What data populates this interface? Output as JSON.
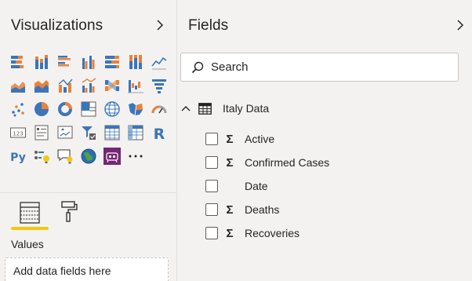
{
  "visualizations": {
    "title": "Visualizations",
    "chevron_icon": "chevron-right-icon",
    "tiles": [
      {
        "name": "stacked-bar-chart-icon"
      },
      {
        "name": "stacked-column-chart-icon"
      },
      {
        "name": "clustered-bar-chart-icon"
      },
      {
        "name": "clustered-column-chart-icon"
      },
      {
        "name": "100-stacked-bar-chart-icon"
      },
      {
        "name": "100-stacked-column-chart-icon"
      },
      {
        "name": "line-chart-icon"
      },
      {
        "name": "area-chart-icon"
      },
      {
        "name": "stacked-area-chart-icon"
      },
      {
        "name": "line-and-stacked-column-chart-icon"
      },
      {
        "name": "line-and-clustered-column-chart-icon"
      },
      {
        "name": "ribbon-chart-icon"
      },
      {
        "name": "waterfall-chart-icon"
      },
      {
        "name": "funnel-chart-icon"
      },
      {
        "name": "scatter-chart-icon"
      },
      {
        "name": "pie-chart-icon"
      },
      {
        "name": "donut-chart-icon"
      },
      {
        "name": "treemap-icon"
      },
      {
        "name": "map-icon"
      },
      {
        "name": "filled-map-icon"
      },
      {
        "name": "gauge-icon"
      },
      {
        "name": "card-icon",
        "text": "123"
      },
      {
        "name": "multi-row-card-icon"
      },
      {
        "name": "kpi-icon"
      },
      {
        "name": "slicer-icon"
      },
      {
        "name": "table-icon"
      },
      {
        "name": "matrix-icon"
      },
      {
        "name": "r-visual-icon",
        "text": "R"
      },
      {
        "name": "python-visual-icon",
        "text": "Py"
      },
      {
        "name": "key-influencers-icon"
      },
      {
        "name": "qna-icon"
      },
      {
        "name": "arcgis-map-icon"
      },
      {
        "name": "custom-visual-icon"
      },
      {
        "name": "more-visuals-icon",
        "text": "···"
      }
    ],
    "tabs": {
      "fields_icon": "fields-well-icon",
      "format_icon": "paint-roller-icon"
    },
    "values_label": "Values",
    "drop_zone_text": "Add data fields here"
  },
  "fields": {
    "title": "Fields",
    "chevron_icon": "chevron-right-icon",
    "search": {
      "placeholder": "Search",
      "value": ""
    },
    "table": {
      "name": "Italy Data",
      "expanded": true,
      "fields": [
        {
          "name": "Active",
          "aggregate": true,
          "checked": false
        },
        {
          "name": "Confirmed Cases",
          "aggregate": true,
          "checked": false
        },
        {
          "name": "Date",
          "aggregate": false,
          "checked": false
        },
        {
          "name": "Deaths",
          "aggregate": true,
          "checked": false
        },
        {
          "name": "Recoveries",
          "aggregate": true,
          "checked": false
        }
      ]
    }
  },
  "colors": {
    "accent_yellow": "#f2c811",
    "chart_blue": "#3b75bb",
    "chart_orange": "#e8833a",
    "custom_visual_purple": "#742774"
  }
}
